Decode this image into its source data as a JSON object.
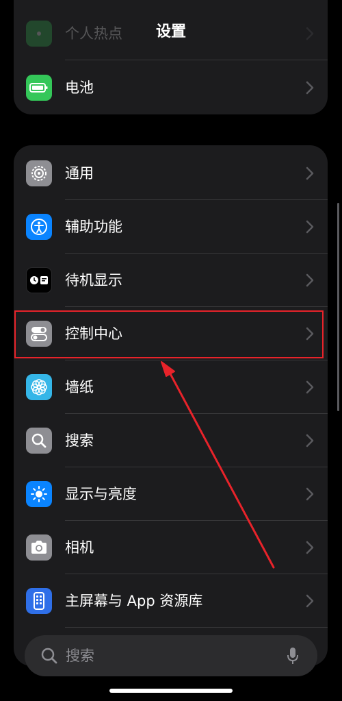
{
  "header": {
    "title": "设置"
  },
  "top_group": [
    {
      "label": "个人热点",
      "icon": "hotspot-icon",
      "color": "#34c759",
      "faded": true
    },
    {
      "label": "电池",
      "icon": "battery-icon",
      "color": "#34c759"
    }
  ],
  "main_group": [
    {
      "label": "通用",
      "icon": "gear-icon",
      "color": "#8e8e93"
    },
    {
      "label": "辅助功能",
      "icon": "accessibility-icon",
      "color": "#0a84ff"
    },
    {
      "label": "待机显示",
      "icon": "standby-icon",
      "color": "#000000"
    },
    {
      "label": "控制中心",
      "icon": "control-center-icon",
      "color": "#8e8e93"
    },
    {
      "label": "墙纸",
      "icon": "wallpaper-flower-icon",
      "color": "#35b6e8"
    },
    {
      "label": "搜索",
      "icon": "search-icon",
      "color": "#8e8e93"
    },
    {
      "label": "显示与亮度",
      "icon": "brightness-icon",
      "color": "#0a84ff"
    },
    {
      "label": "相机",
      "icon": "camera-icon",
      "color": "#8e8e93"
    },
    {
      "label": "主屏幕与 App 资源库",
      "icon": "home-screen-icon",
      "color": "#2f6fe8"
    }
  ],
  "search": {
    "placeholder": "搜索"
  },
  "annotation": {
    "color": "#e8232a",
    "highlighted_item": "控制中心"
  }
}
